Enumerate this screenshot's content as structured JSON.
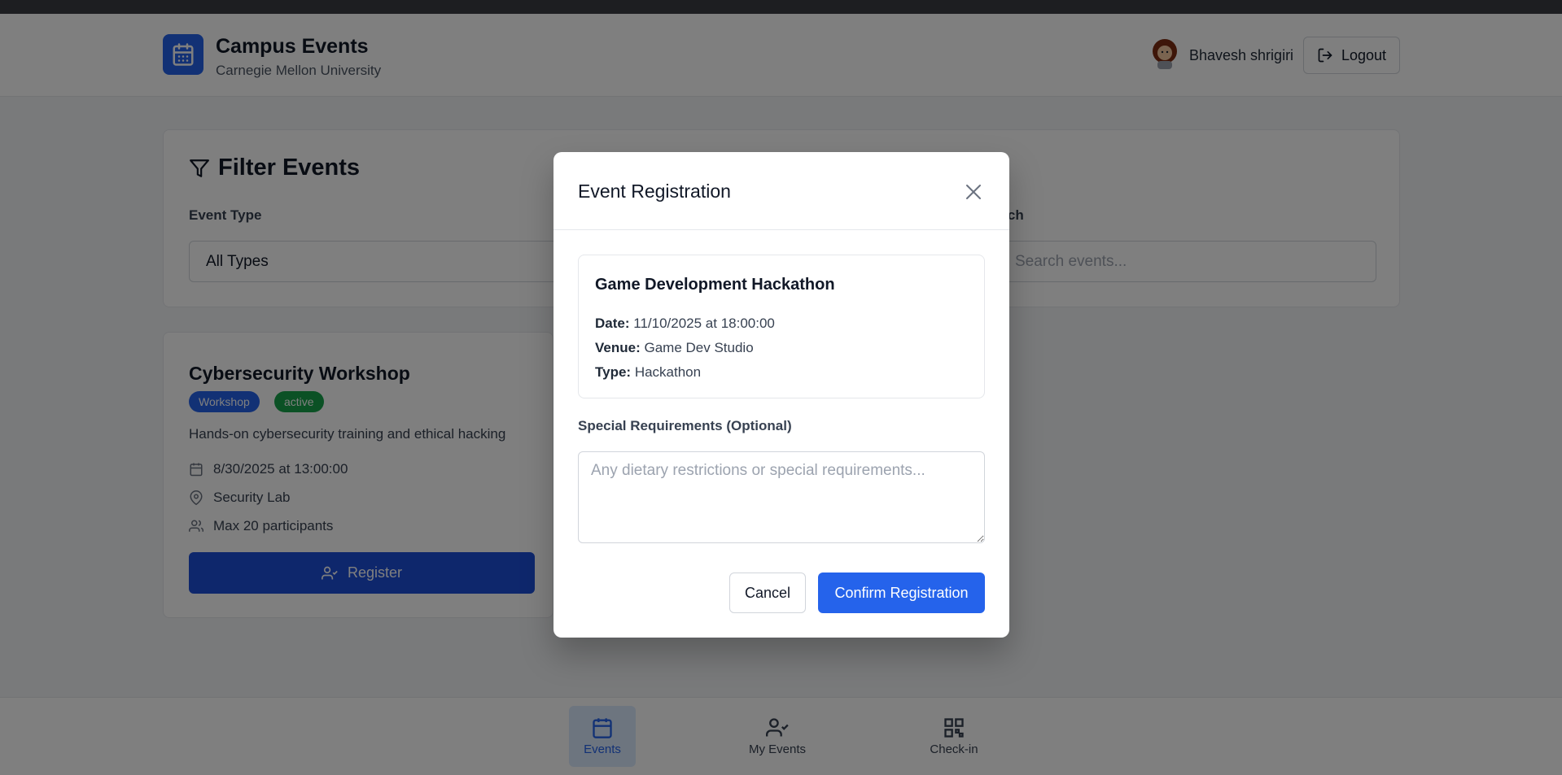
{
  "header": {
    "app_title": "Campus Events",
    "app_subtitle": "Carnegie Mellon University",
    "user_name": "Bhavesh shrigiri",
    "logout_label": "Logout"
  },
  "filters": {
    "title": "Filter Events",
    "event_type_label": "Event Type",
    "event_type_value": "All Types",
    "search_label": "Search",
    "search_placeholder": "Search events..."
  },
  "event_card": {
    "title": "Cybersecurity Workshop",
    "type_badge": "Workshop",
    "status_badge": "active",
    "description": "Hands-on cybersecurity training and ethical hacking",
    "date": "8/30/2025 at 13:00:00",
    "venue": "Security Lab",
    "capacity": "Max 20 participants",
    "register_label": "Register"
  },
  "bottom_nav": {
    "events_label": "Events",
    "my_events_label": "My Events",
    "checkin_label": "Check-in"
  },
  "modal": {
    "title": "Event Registration",
    "event_title": "Game Development Hackathon",
    "date_label": "Date:",
    "date_value": "11/10/2025 at 18:00:00",
    "venue_label": "Venue:",
    "venue_value": "Game Dev Studio",
    "type_label": "Type:",
    "type_value": "Hackathon",
    "requirements_label": "Special Requirements (Optional)",
    "requirements_placeholder": "Any dietary restrictions or special requirements...",
    "cancel_label": "Cancel",
    "confirm_label": "Confirm Registration"
  },
  "colors": {
    "primary": "#2563eb",
    "active_badge": "#16a34a",
    "overlay": "rgba(0,0,0,0.5)"
  }
}
